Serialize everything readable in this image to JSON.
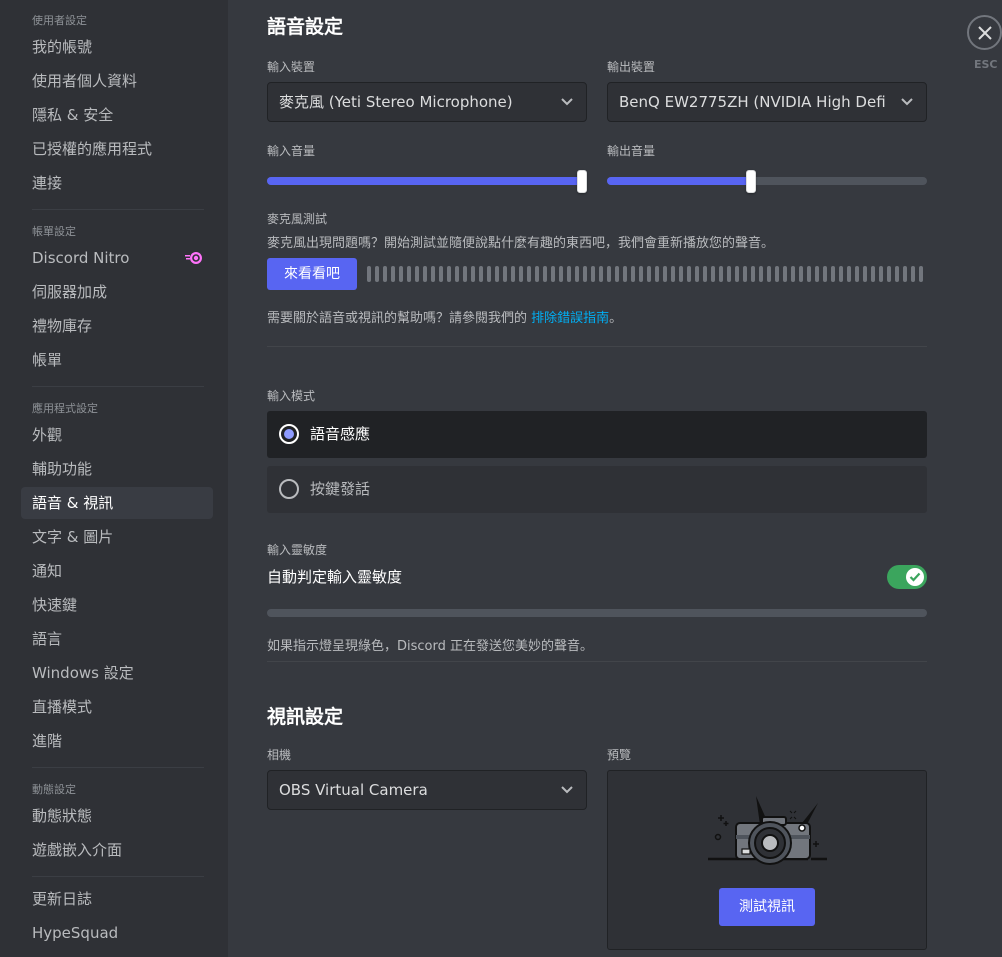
{
  "sidebar": {
    "sections": [
      {
        "header": "使用者設定",
        "items": [
          {
            "label": "我的帳號"
          },
          {
            "label": "使用者個人資料"
          },
          {
            "label": "隱私 & 安全"
          },
          {
            "label": "已授權的應用程式"
          },
          {
            "label": "連接"
          }
        ]
      },
      {
        "header": "帳單設定",
        "items": [
          {
            "label": "Discord Nitro",
            "icon": "nitro-icon"
          },
          {
            "label": "伺服器加成"
          },
          {
            "label": "禮物庫存"
          },
          {
            "label": "帳單"
          }
        ]
      },
      {
        "header": "應用程式設定",
        "items": [
          {
            "label": "外觀"
          },
          {
            "label": "輔助功能"
          },
          {
            "label": "語音 & 視訊",
            "active": true
          },
          {
            "label": "文字 & 圖片"
          },
          {
            "label": "通知"
          },
          {
            "label": "快速鍵"
          },
          {
            "label": "語言"
          },
          {
            "label": "Windows 設定"
          },
          {
            "label": "直播模式"
          },
          {
            "label": "進階"
          }
        ]
      },
      {
        "header": "動態設定",
        "items": [
          {
            "label": "動態狀態"
          },
          {
            "label": "遊戲嵌入介面"
          }
        ]
      },
      {
        "header": "",
        "items": [
          {
            "label": "更新日誌"
          },
          {
            "label": "HypeSquad"
          }
        ]
      }
    ]
  },
  "voice": {
    "title": "語音設定",
    "input_device_label": "輸入裝置",
    "input_device_value": "麥克風 (Yeti Stereo Microphone)",
    "output_device_label": "輸出裝置",
    "output_device_value": "BenQ EW2775ZH (NVIDIA High Defi",
    "input_volume_label": "輸入音量",
    "input_volume_percent": 100,
    "output_volume_label": "輸出音量",
    "output_volume_percent": 45,
    "mic_test_label": "麥克風測試",
    "mic_test_desc": "麥克風出現問題嗎？開始測試並隨便說點什麼有趣的東西吧，我們會重新播放您的聲音。",
    "mic_test_button": "來看看吧",
    "help_text": "需要關於語音或視訊的幫助嗎？請參閱我們的 ",
    "help_link": "排除錯誤指南",
    "help_suffix": "。",
    "input_mode_label": "輸入模式",
    "input_modes": [
      {
        "label": "語音感應",
        "selected": true
      },
      {
        "label": "按鍵發話",
        "selected": false
      }
    ],
    "sensitivity_label": "輸入靈敏度",
    "auto_sensitivity_label": "自動判定輸入靈敏度",
    "auto_sensitivity_enabled": true,
    "sensitivity_note": "如果指示燈呈現綠色，Discord 正在發送您美妙的聲音。"
  },
  "video": {
    "title": "視訊設定",
    "camera_label": "相機",
    "camera_value": "OBS Virtual Camera",
    "preview_label": "預覽",
    "test_video_button": "測試視訊"
  },
  "close": {
    "esc_label": "ESC"
  },
  "colors": {
    "accent": "#5865f2",
    "link": "#00aff4",
    "toggle_on": "#3ba55d",
    "nitro": "#ff73fa"
  }
}
